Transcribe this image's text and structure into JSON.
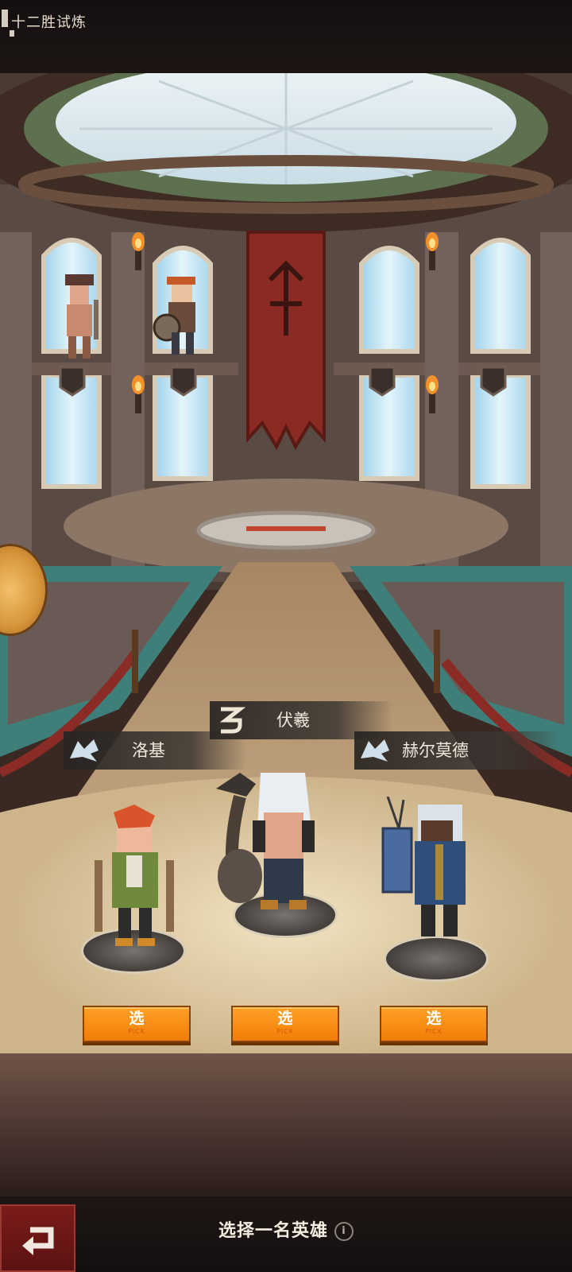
{
  "window": {
    "title": "十二胜试炼"
  },
  "heroes": [
    {
      "name": "洛基",
      "emblem": "wolf-emblem-icon",
      "pick_cn": "选",
      "pick_en": "PICK"
    },
    {
      "name": "伏羲",
      "emblem": "serpent-emblem-icon",
      "pick_cn": "选",
      "pick_en": "PICK"
    },
    {
      "name": "赫尔莫德",
      "emblem": "wolf-emblem-icon",
      "pick_cn": "选",
      "pick_en": "PICK"
    }
  ],
  "footer": {
    "instruction": "选择一名英雄",
    "back_icon": "return-arrow-icon",
    "info_icon": "i"
  },
  "colors": {
    "accent": "#f58a10",
    "back_button": "#6e1716",
    "panel": "#2a2422"
  }
}
